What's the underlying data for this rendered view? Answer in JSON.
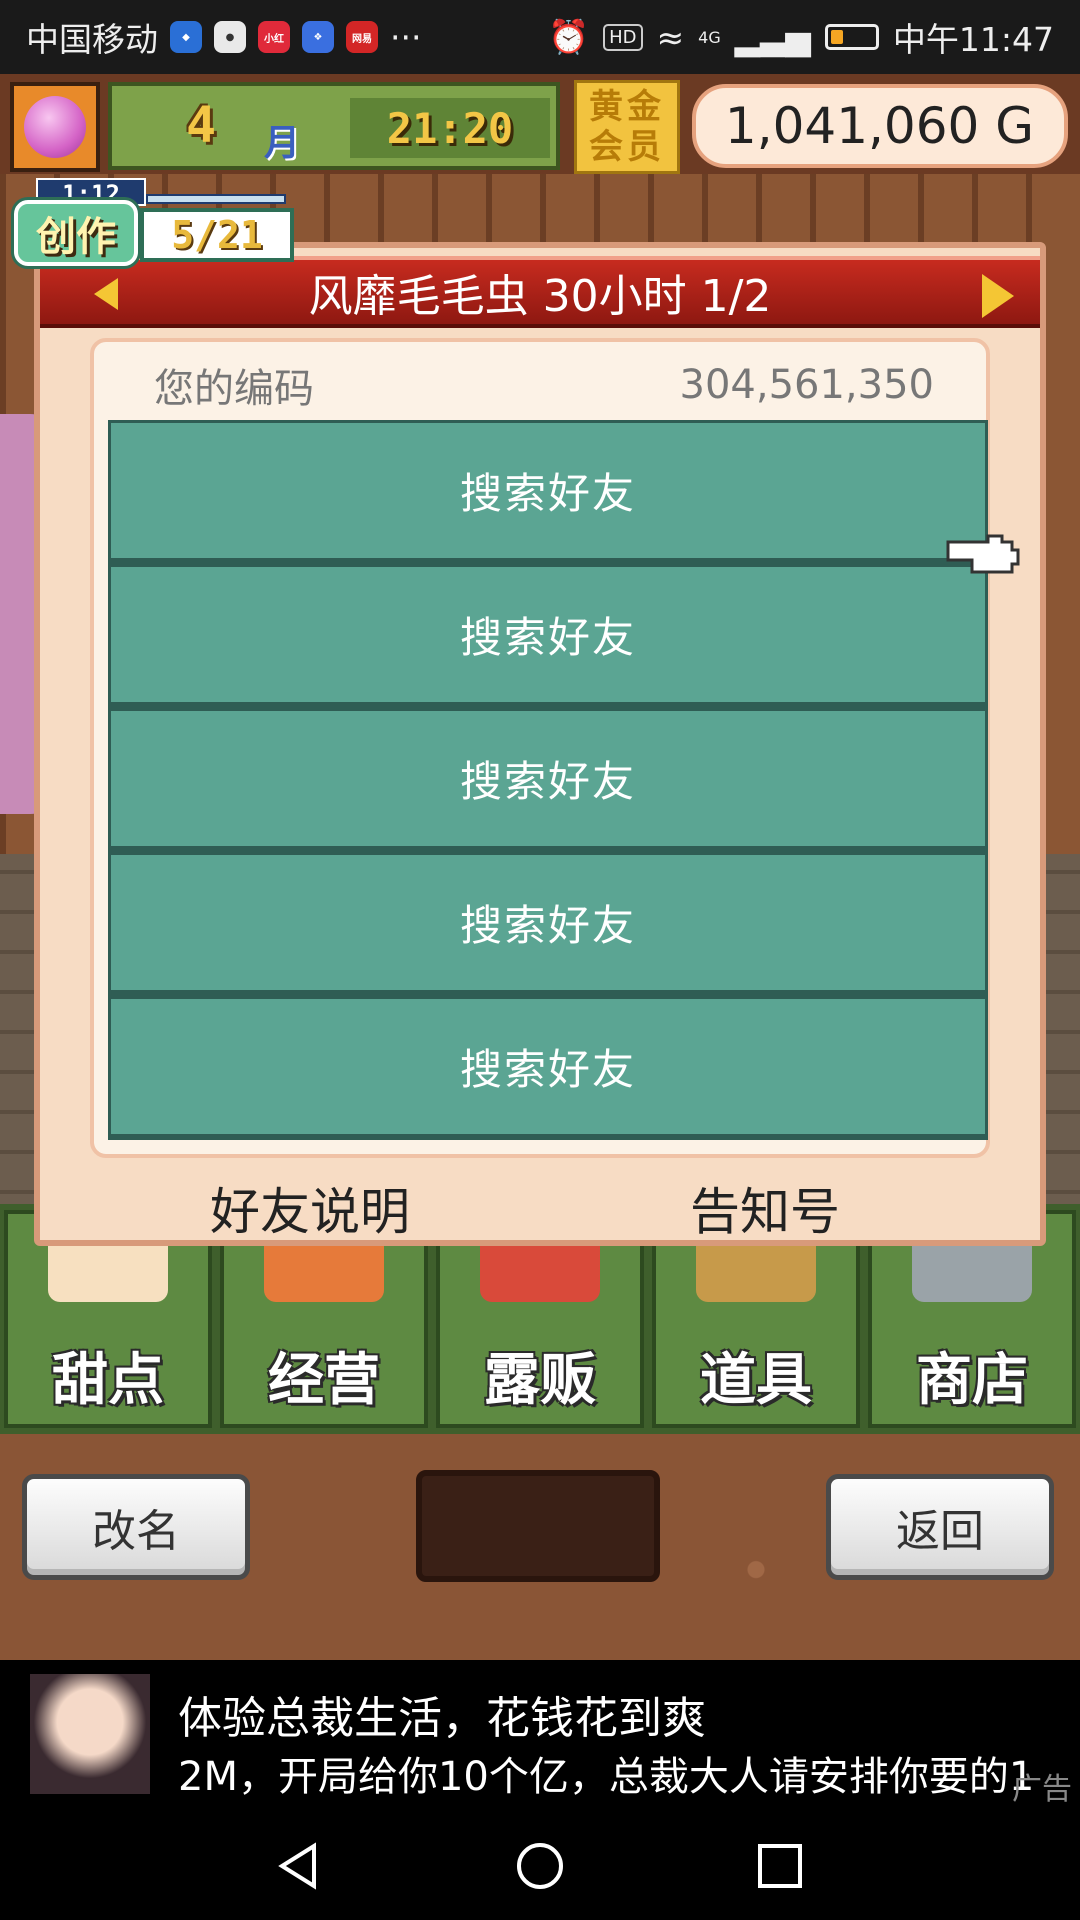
{
  "status_bar": {
    "carrier": "中国移动",
    "more": "···",
    "hd": "HD",
    "network": "4G",
    "time": "中午11:47",
    "app_icons": [
      {
        "name": "shield-icon",
        "color": "#2a6fd6"
      },
      {
        "name": "browser-icon",
        "color": "#e9e9e9"
      },
      {
        "name": "xiaohongshu-icon",
        "color": "#e02a3a"
      },
      {
        "name": "baidu-icon",
        "color": "#3a6fe0"
      },
      {
        "name": "netease-icon",
        "color": "#d32626"
      }
    ]
  },
  "hud": {
    "month_number": "4",
    "month_label": "月",
    "clock": "21:20",
    "gold_member_line1": "黄金",
    "gold_member_line2": "会员",
    "money": "1,041,060 G"
  },
  "creation": {
    "timer": "1:12",
    "tag": "创作",
    "count": "5/21"
  },
  "dialog": {
    "title": "风靡毛毛虫  30小时 1/2",
    "code_label": "您的编码",
    "code_value": "304,561,350",
    "friend_slots": [
      "搜索好友",
      "搜索好友",
      "搜索好友",
      "搜索好友",
      "搜索好友"
    ],
    "footer_left": "好友说明",
    "footer_right": "告知号"
  },
  "categories": [
    {
      "label": "甜点",
      "thumb_color": "#f7e0c0"
    },
    {
      "label": "经营",
      "thumb_color": "#e67a3a"
    },
    {
      "label": "露贩",
      "thumb_color": "#d94a3a"
    },
    {
      "label": "道具",
      "thumb_color": "#c79a4a"
    },
    {
      "label": "商店",
      "thumb_color": "#9aa3a8"
    }
  ],
  "bottom_bar": {
    "rename_label": "改名",
    "back_label": "返回"
  },
  "ad": {
    "title": "体验总裁生活，花钱花到爽",
    "subtitle": "2M，开局给你10个亿，总裁大人请安排你要的1",
    "tag": "广告"
  },
  "colors": {
    "slot_teal": "#5ba593",
    "header_red": "#c72b1f",
    "gold": "#f2c33f"
  }
}
